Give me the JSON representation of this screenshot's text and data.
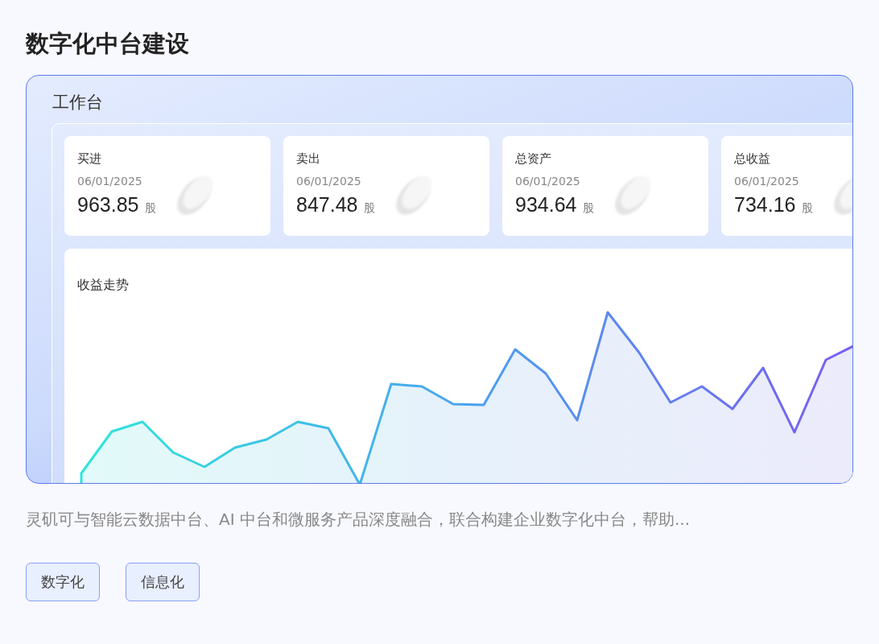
{
  "title": "数字化中台建设",
  "workbench": {
    "title": "工作台",
    "stats": [
      {
        "label": "买进",
        "date": "06/01/2025",
        "value": "963.85",
        "unit": "股"
      },
      {
        "label": "卖出",
        "date": "06/01/2025",
        "value": "847.48",
        "unit": "股"
      },
      {
        "label": "总资产",
        "date": "06/01/2025",
        "value": "934.64",
        "unit": "股"
      },
      {
        "label": "总收益",
        "date": "06/01/2025",
        "value": "734.16",
        "unit": "股"
      }
    ],
    "chart_card": {
      "title": "收益走势"
    }
  },
  "description": "灵矶可与智能云数据中台、AI 中台和微服务产品深度融合，联合构建企业数字化中台，帮助...",
  "tags": [
    "数字化",
    "信息化"
  ]
}
